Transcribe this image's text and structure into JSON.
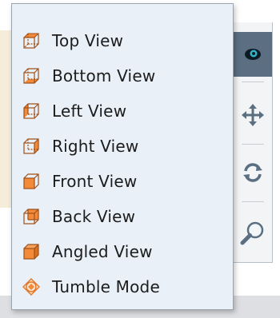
{
  "menu": {
    "items": [
      {
        "label": "Top View",
        "icon": "cube-top-icon"
      },
      {
        "label": "Bottom View",
        "icon": "cube-bottom-icon"
      },
      {
        "label": "Left View",
        "icon": "cube-left-icon"
      },
      {
        "label": "Right View",
        "icon": "cube-right-icon"
      },
      {
        "label": "Front View",
        "icon": "cube-front-icon"
      },
      {
        "label": "Back View",
        "icon": "cube-back-icon"
      },
      {
        "label": "Angled View",
        "icon": "cube-angled-icon"
      },
      {
        "label": "Tumble Mode",
        "icon": "tumble-mode-icon"
      }
    ]
  },
  "toolbar": {
    "tools": [
      "view-mode-icon",
      "pan-icon",
      "rotate-icon",
      "zoom-icon"
    ]
  },
  "colors": {
    "menu_bg": "#e9f0f7",
    "accent_orange": "#f28a3a",
    "active_tool_bg": "#5b6e82",
    "toolbar_icon": "#5b6f82"
  }
}
